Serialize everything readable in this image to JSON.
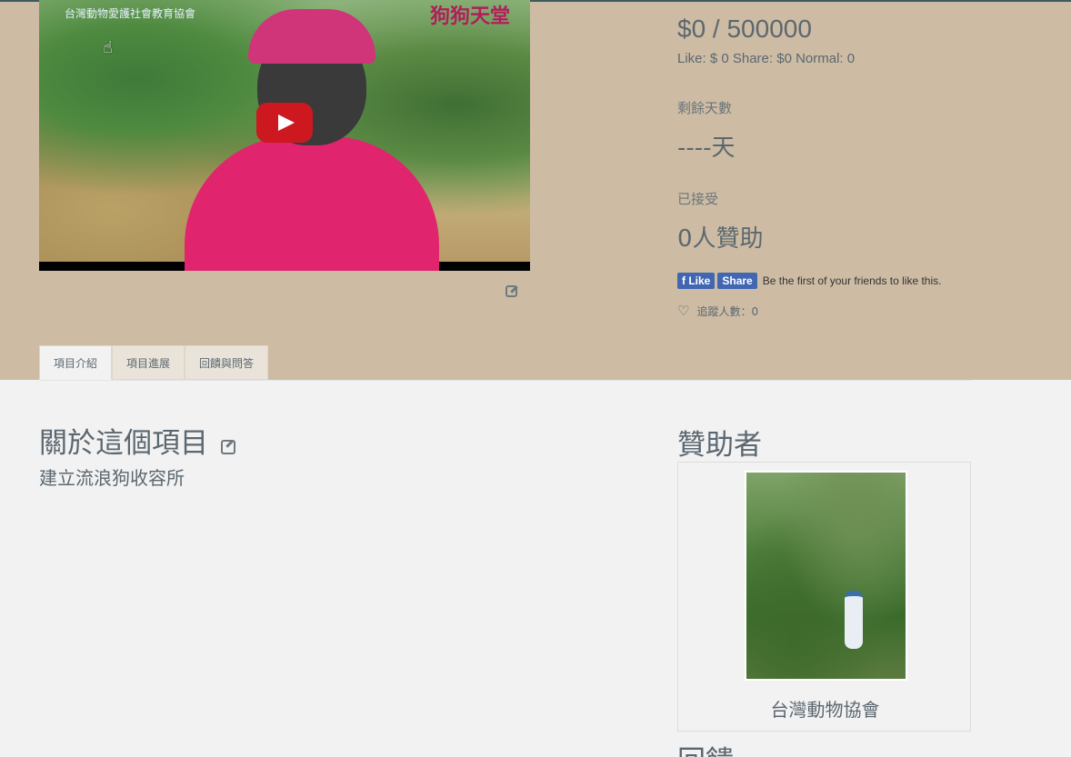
{
  "video": {
    "logo_left": "台灣動物愛護社會教育協會",
    "logo_right": "狗狗天堂"
  },
  "stats": {
    "amount": "$0 / 500000",
    "breakdown": "Like: $ 0 Share: $0 Normal: 0",
    "days_label": "剩餘天數",
    "days_value": "----天",
    "accepted_label": "已接受",
    "accepted_value": "0人贊助"
  },
  "facebook": {
    "like_label": "Like",
    "share_label": "Share",
    "social_text": "Be the first of your friends to like this."
  },
  "follow": {
    "text": "追蹤人數：0"
  },
  "tabs": [
    {
      "label": "項目介紹"
    },
    {
      "label": "項目進展"
    },
    {
      "label": "回饋與問答"
    }
  ],
  "about": {
    "title": "關於這個項目",
    "body": "建立流浪狗收容所"
  },
  "sponsors": {
    "title": "贊助者",
    "name": "台灣動物協會"
  },
  "feedback": {
    "title": "回饋"
  },
  "colors": {
    "hero_bg": "#cdbca3",
    "page_bg": "#f2f2f2",
    "text": "#5b6770",
    "fb_blue": "#4267b2",
    "play_red": "#cc181e"
  }
}
